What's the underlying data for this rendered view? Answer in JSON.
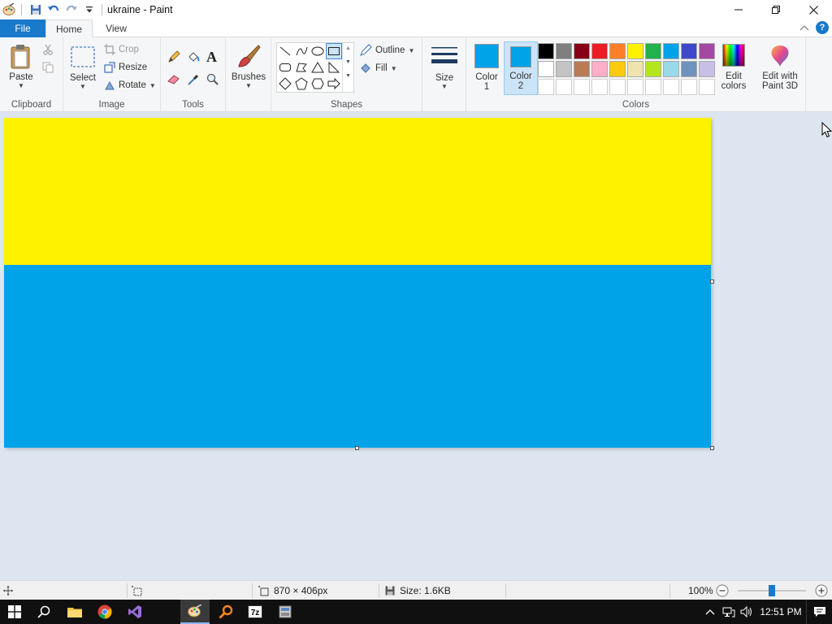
{
  "window": {
    "title": "ukraine - Paint"
  },
  "tabs": {
    "file": "File",
    "home": "Home",
    "view": "View"
  },
  "ribbon": {
    "clipboard": {
      "label": "Clipboard",
      "paste": "Paste"
    },
    "image": {
      "label": "Image",
      "select": "Select",
      "crop": "Crop",
      "resize": "Resize",
      "rotate": "Rotate"
    },
    "tools": {
      "label": "Tools"
    },
    "brushes": {
      "label": "Brushes"
    },
    "shapes": {
      "label": "Shapes",
      "outline": "Outline",
      "fill": "Fill"
    },
    "size": {
      "label": "Size"
    },
    "colors": {
      "label": "Colors",
      "color1_label": "Color\n1",
      "color1_line1": "Color",
      "color1_line2": "1",
      "color2_line1": "Color",
      "color2_line2": "2",
      "color1": "#00a2e8",
      "color2": "#00a2e8",
      "edit_line1": "Edit",
      "edit_line2": "colors",
      "paint3d_line1": "Edit with",
      "paint3d_line2": "Paint 3D",
      "palette_row1": [
        "#000000",
        "#7f7f7f",
        "#880015",
        "#ed1c24",
        "#ff7f27",
        "#fff200",
        "#22b14c",
        "#00a2e8",
        "#3f48cc",
        "#a349a4"
      ],
      "palette_row2": [
        "#ffffff",
        "#c3c3c3",
        "#b97a57",
        "#ffaec9",
        "#ffc90e",
        "#efe4b0",
        "#b5e61d",
        "#99d9ea",
        "#7092be",
        "#c8bfe7"
      ]
    }
  },
  "canvas": {
    "top_color": "#fff200",
    "bottom_color": "#00a2e8"
  },
  "status": {
    "dimensions": "870 × 406px",
    "size": "Size: 1.6KB",
    "zoom": "100%"
  },
  "taskbar": {
    "clock": "12:51 PM"
  }
}
